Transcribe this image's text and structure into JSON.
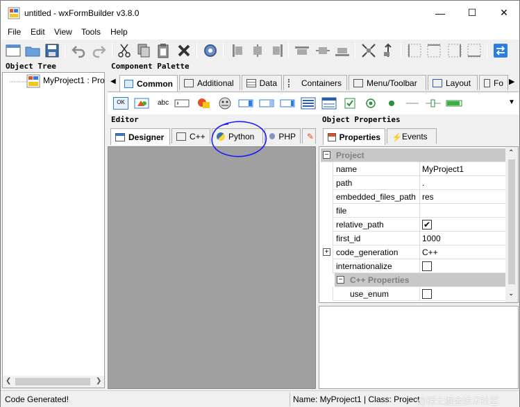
{
  "window": {
    "title": "untitled - wxFormBuilder v3.8.0",
    "minimize": "—",
    "maximize": "☐",
    "close": "✕"
  },
  "menu": [
    "File",
    "Edit",
    "View",
    "Tools",
    "Help"
  ],
  "object_tree": {
    "title": "Object Tree",
    "root_label": "MyProject1 : Pro"
  },
  "component_palette": {
    "title": "Component Palette",
    "tabs": [
      "Common",
      "Additional",
      "Data",
      "Containers",
      "Menu/Toolbar",
      "Layout",
      "Fo"
    ],
    "active_tab": "Common",
    "item_labels": {
      "button": "OK",
      "static_text": "abc"
    }
  },
  "editor": {
    "title": "Editor",
    "tabs": [
      "Designer",
      "C++",
      "Python",
      "PHP"
    ],
    "active_tab": "Designer"
  },
  "object_properties": {
    "title": "Object Properties",
    "tabs": [
      "Properties",
      "Events"
    ],
    "active_tab": "Properties",
    "rows": [
      {
        "type": "category",
        "label": "Project"
      },
      {
        "name": "name",
        "value": "MyProject1"
      },
      {
        "name": "path",
        "value": "."
      },
      {
        "name": "embedded_files_path",
        "value": "res"
      },
      {
        "name": "file",
        "value": ""
      },
      {
        "name": "relative_path",
        "checkbox": true,
        "checked": true
      },
      {
        "name": "first_id",
        "value": "1000"
      },
      {
        "name": "code_generation",
        "value": "C++",
        "expandable": true
      },
      {
        "name": "internationalize",
        "checkbox": true,
        "checked": false
      },
      {
        "type": "subcategory",
        "label": "C++ Properties"
      },
      {
        "name": "use_enum",
        "checkbox": true,
        "checked": false,
        "indent": true
      }
    ]
  },
  "status": {
    "left": "Code Generated!",
    "right": "Name: MyProject1 | Class: Project",
    "watermark": "@稀土掘金技术社区"
  },
  "colors": {
    "annotation_circle": "#1a1aff",
    "editor_canvas": "#a0a0a0",
    "accent": "#0078d7"
  }
}
